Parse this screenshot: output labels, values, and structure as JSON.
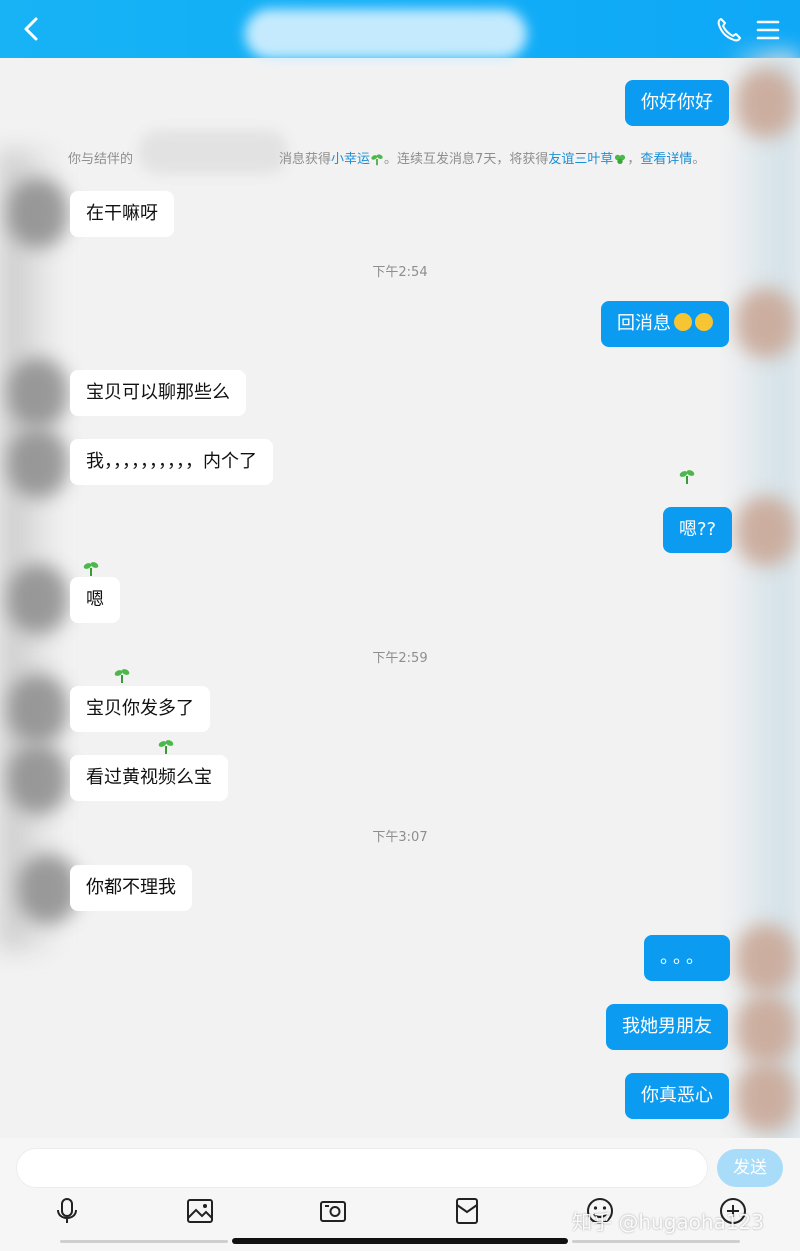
{
  "header": {
    "title": ""
  },
  "system_notice": {
    "prefix": "你与结伴的",
    "middle": "消息获得",
    "badge1": "小幸运",
    "middle2": "。连续互发消息7天，将获得",
    "badge2": "友谊三叶草",
    "sep": "，",
    "link": "查看详情",
    "end": "。"
  },
  "messages": [
    {
      "side": "right",
      "text": "你好你好"
    },
    {
      "side": "left",
      "text": "在干嘛呀"
    },
    {
      "type": "time",
      "text": "下午2:54"
    },
    {
      "side": "right",
      "text": "回消息"
    },
    {
      "side": "left",
      "text": "宝贝可以聊那些么"
    },
    {
      "side": "left",
      "text": "我，，，，，，，，，，内个了"
    },
    {
      "side": "right",
      "text": "嗯??"
    },
    {
      "side": "left",
      "text": "嗯"
    },
    {
      "type": "time",
      "text": "下午2:59"
    },
    {
      "side": "left",
      "text": "宝贝你发多了"
    },
    {
      "side": "left",
      "text": "看过黄视频么宝"
    },
    {
      "type": "time",
      "text": "下午3:07"
    },
    {
      "side": "left",
      "text": "你都不理我"
    },
    {
      "side": "right",
      "text": "。。。"
    },
    {
      "side": "right",
      "text": "我她男朋友"
    },
    {
      "side": "right",
      "text": "你真恶心"
    }
  ],
  "composer": {
    "send_label": "发送",
    "input_value": ""
  },
  "watermark": "知乎 @hugaoha123",
  "colors": {
    "header": "#12aef7",
    "bubble_right": "#0b9cf2",
    "bubble_left": "#ffffff",
    "send": "#a8dcf8"
  },
  "icons": [
    "back-icon",
    "phone-icon",
    "menu-icon",
    "mic-icon",
    "image-icon",
    "camera-icon",
    "red-packet-icon",
    "emoji-icon",
    "plus-icon",
    "sprout-icon"
  ]
}
